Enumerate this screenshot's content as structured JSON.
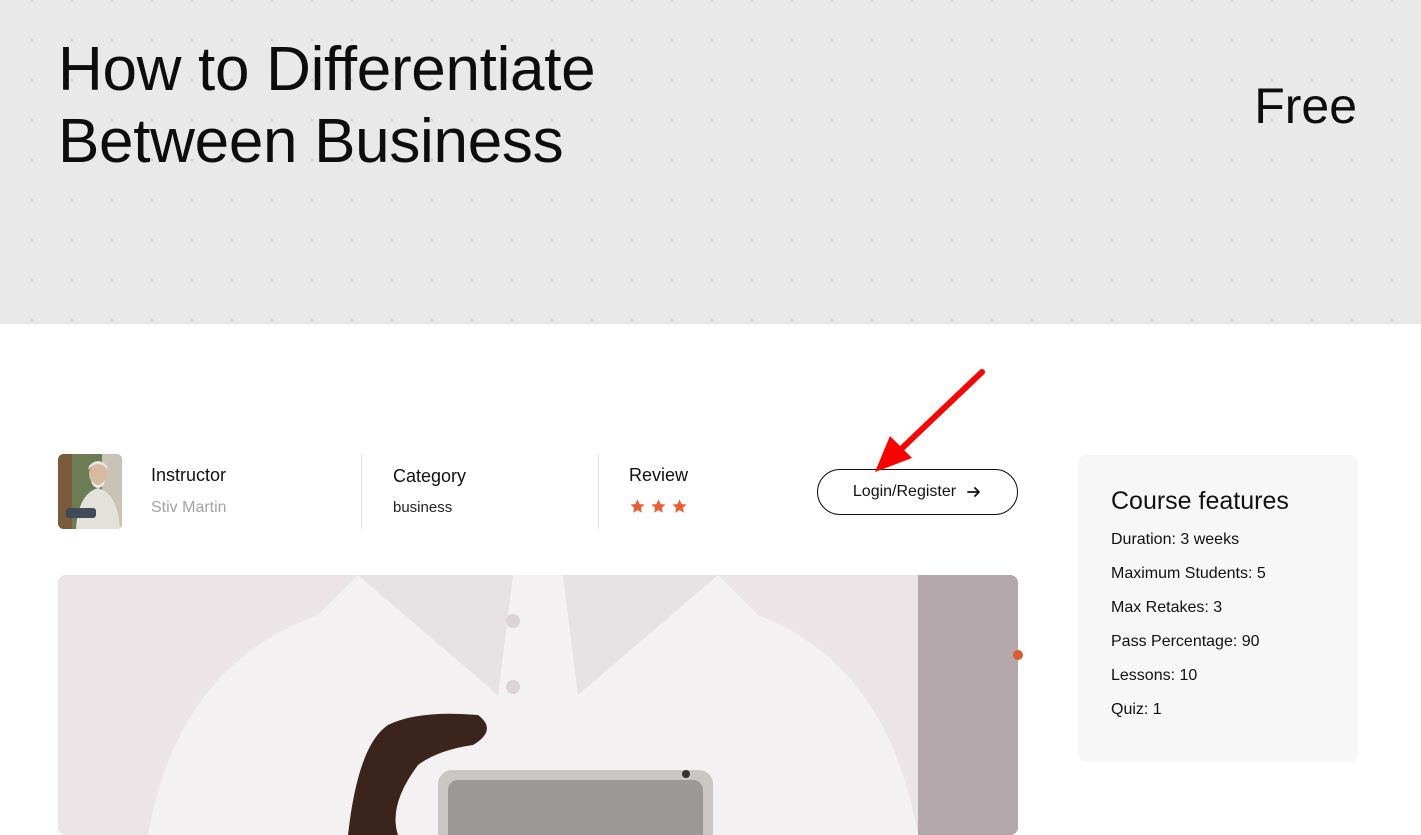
{
  "hero": {
    "title_line1": "How to Differentiate",
    "title_line2": "Between Business",
    "price": "Free"
  },
  "meta": {
    "instructor_label": "Instructor",
    "instructor_name": "Stiv Martin",
    "category_label": "Category",
    "category_value": "business",
    "review_label": "Review",
    "rating_stars": 3,
    "star_color": "#ee5a33"
  },
  "actions": {
    "login_label": "Login/Register",
    "login_icon": "arrow-right-icon"
  },
  "features": {
    "heading": "Course features",
    "items": [
      "Duration: 3 weeks",
      "Maximum Students: 5",
      "Max Retakes: 3",
      "Pass Percentage: 90",
      "Lessons: 10",
      "Quiz: 1"
    ]
  },
  "colors": {
    "accent": "#e0582e",
    "hero_bg": "#e9e9e9",
    "annotation": "#ff0000"
  }
}
